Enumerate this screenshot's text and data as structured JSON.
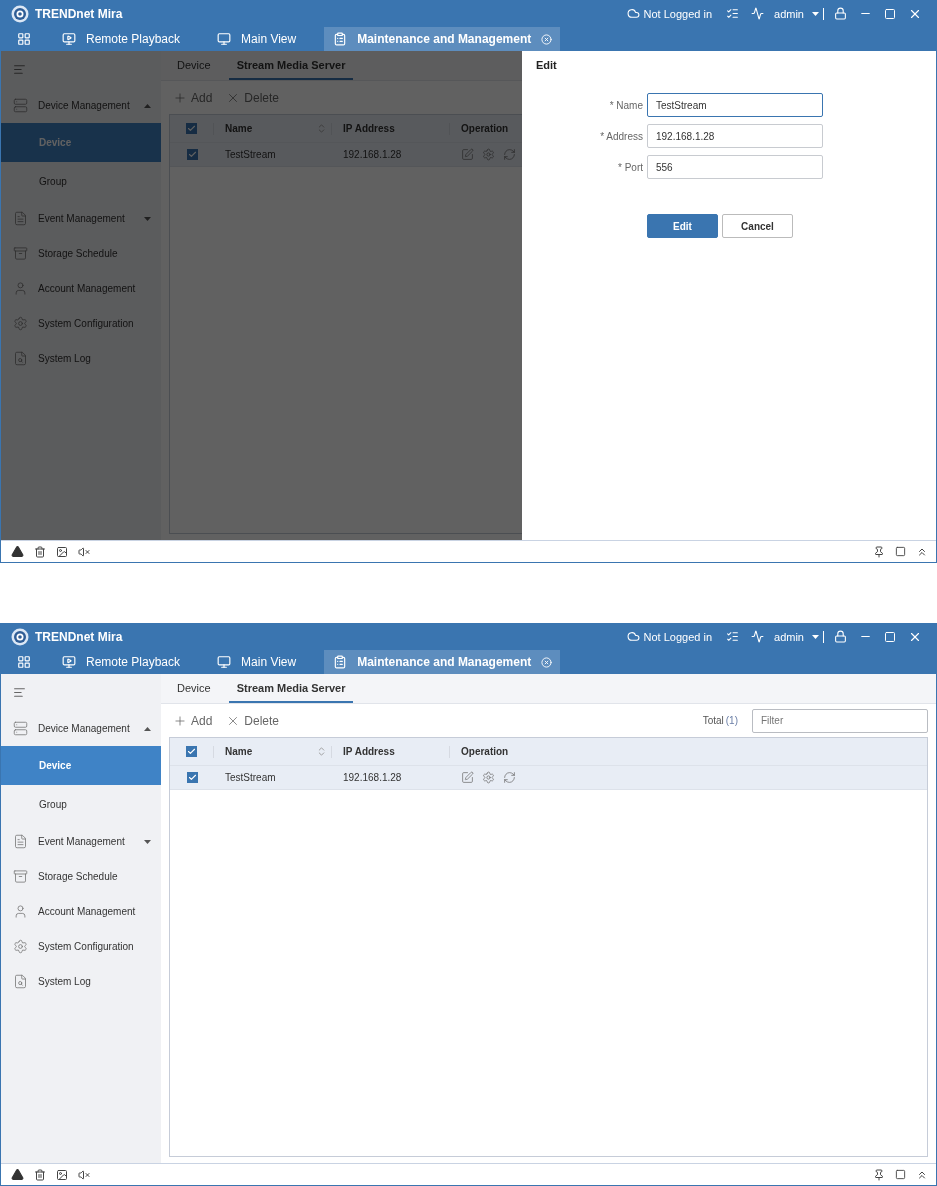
{
  "screens": [
    {
      "title": "TRENDnet Mira",
      "login_status": "Not Logged in",
      "user": "admin",
      "tabs": [
        {
          "label": "Remote Playback",
          "kind": "playback",
          "selected": false
        },
        {
          "label": "Main View",
          "kind": "view",
          "selected": false
        },
        {
          "label": "Maintenance and Management",
          "kind": "maintenance",
          "selected": true
        }
      ],
      "sidebar": {
        "items": [
          {
            "label": "Device Management",
            "kind": "device",
            "expanded": true,
            "children": [
              {
                "label": "Device",
                "selected": true
              },
              {
                "label": "Group",
                "selected": false
              }
            ]
          },
          {
            "label": "Event Management",
            "kind": "event",
            "expanded": false
          },
          {
            "label": "Storage Schedule",
            "kind": "storage"
          },
          {
            "label": "Account Management",
            "kind": "account"
          },
          {
            "label": "System Configuration",
            "kind": "config"
          },
          {
            "label": "System Log",
            "kind": "log"
          }
        ]
      },
      "subtabs": [
        {
          "label": "Device",
          "selected": false
        },
        {
          "label": "Stream Media Server",
          "selected": true
        }
      ],
      "toolbar": {
        "add": "Add",
        "delete": "Delete"
      },
      "table": {
        "columns": [
          "Name",
          "IP Address",
          "Operation"
        ],
        "all_checked": true,
        "rows": [
          {
            "checked": true,
            "name": "TestStream",
            "ip_address": "192.168.1.28"
          }
        ]
      },
      "dialog": {
        "title": "Edit",
        "fields": [
          {
            "label": "* Name",
            "value": "TestStream",
            "focused": true
          },
          {
            "label": "* Address",
            "value": "192.168.1.28",
            "focused": false
          },
          {
            "label": "* Port",
            "value": "556",
            "focused": false
          }
        ],
        "buttons": [
          {
            "label": "Edit",
            "kind": "primary"
          },
          {
            "label": "Cancel",
            "kind": "secondary"
          }
        ]
      }
    },
    {
      "title": "TRENDnet Mira",
      "login_status": "Not Logged in",
      "user": "admin",
      "tabs": [
        {
          "label": "Remote Playback",
          "kind": "playback",
          "selected": false
        },
        {
          "label": "Main View",
          "kind": "view",
          "selected": false
        },
        {
          "label": "Maintenance and Management",
          "kind": "maintenance",
          "selected": true
        }
      ],
      "sidebar": {
        "items": [
          {
            "label": "Device Management",
            "kind": "device",
            "expanded": true,
            "children": [
              {
                "label": "Device",
                "selected": true
              },
              {
                "label": "Group",
                "selected": false
              }
            ]
          },
          {
            "label": "Event Management",
            "kind": "event",
            "expanded": false
          },
          {
            "label": "Storage Schedule",
            "kind": "storage"
          },
          {
            "label": "Account Management",
            "kind": "account"
          },
          {
            "label": "System Configuration",
            "kind": "config"
          },
          {
            "label": "System Log",
            "kind": "log"
          }
        ]
      },
      "subtabs": [
        {
          "label": "Device",
          "selected": false
        },
        {
          "label": "Stream Media Server",
          "selected": true
        }
      ],
      "toolbar": {
        "add": "Add",
        "delete": "Delete",
        "total_label": "Total",
        "total_count": "(1)",
        "filter": {
          "placeholder": "Filter"
        }
      },
      "table": {
        "columns": [
          "Name",
          "IP Address",
          "Operation"
        ],
        "all_checked": true,
        "rows": [
          {
            "checked": true,
            "name": "TestStream",
            "ip_address": "192.168.1.28"
          }
        ]
      }
    }
  ]
}
